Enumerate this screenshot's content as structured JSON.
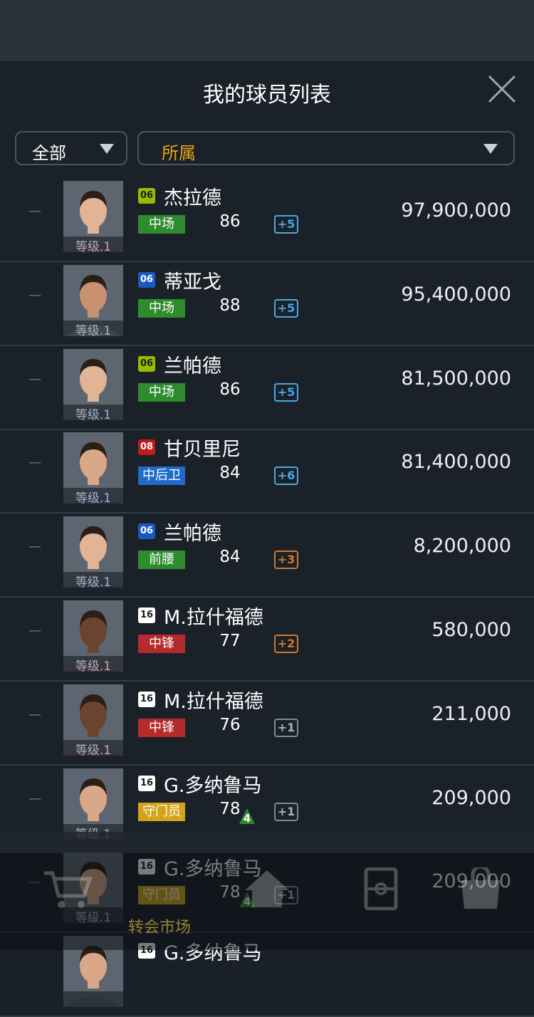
{
  "header": {
    "title": "我的球员列表"
  },
  "filters": {
    "category": "全部",
    "ownership": "所属"
  },
  "players": [
    {
      "dash": "—",
      "season": "06",
      "season_style": "s06g",
      "name": "杰拉德",
      "level": "等级.1",
      "position": "中场",
      "pos_style": "mid",
      "ovr": "86",
      "upgrade": "",
      "boost": "+5",
      "boost_style": "blue",
      "price": "97,900,000"
    },
    {
      "dash": "—",
      "season": "06",
      "season_style": "s06b",
      "name": "蒂亚戈",
      "level": "等级.1",
      "position": "中场",
      "pos_style": "mid",
      "ovr": "88",
      "upgrade": "",
      "boost": "+5",
      "boost_style": "blue",
      "price": "95,400,000"
    },
    {
      "dash": "—",
      "season": "06",
      "season_style": "s06g",
      "name": "兰帕德",
      "level": "等级.1",
      "position": "中场",
      "pos_style": "mid",
      "ovr": "86",
      "upgrade": "",
      "boost": "+5",
      "boost_style": "blue",
      "price": "81,500,000"
    },
    {
      "dash": "—",
      "season": "08",
      "season_style": "s08",
      "name": "甘贝里尼",
      "level": "等级.1",
      "position": "中后卫",
      "pos_style": "def",
      "ovr": "84",
      "upgrade": "",
      "boost": "+6",
      "boost_style": "blue",
      "price": "81,400,000"
    },
    {
      "dash": "—",
      "season": "06",
      "season_style": "s06b",
      "name": "兰帕德",
      "level": "等级.1",
      "position": "前腰",
      "pos_style": "mid",
      "ovr": "84",
      "upgrade": "",
      "boost": "+3",
      "boost_style": "orange",
      "price": "8,200,000"
    },
    {
      "dash": "—",
      "season": "16",
      "season_style": "s16",
      "name": "M.拉什福德",
      "level": "等级.1",
      "position": "中锋",
      "pos_style": "fwd",
      "ovr": "77",
      "upgrade": "",
      "boost": "+2",
      "boost_style": "orange",
      "price": "580,000"
    },
    {
      "dash": "—",
      "season": "16",
      "season_style": "s16",
      "name": "M.拉什福德",
      "level": "等级.1",
      "position": "中锋",
      "pos_style": "fwd",
      "ovr": "76",
      "upgrade": "",
      "boost": "+1",
      "boost_style": "gray",
      "price": "211,000"
    },
    {
      "dash": "—",
      "season": "16",
      "season_style": "s16",
      "name": "G.多纳鲁马",
      "level": "等级.1",
      "position": "守门员",
      "pos_style": "gk",
      "ovr": "78",
      "upgrade": "4",
      "boost": "+1",
      "boost_style": "gray",
      "price": "209,000"
    },
    {
      "dash": "—",
      "season": "16",
      "season_style": "s16",
      "name": "G.多纳鲁马",
      "level": "等级.1",
      "position": "守门员",
      "pos_style": "gk",
      "ovr": "78",
      "upgrade": "4",
      "boost": "+1",
      "boost_style": "gray",
      "price": "209,000"
    },
    {
      "dash": "",
      "season": "16",
      "season_style": "s16",
      "name": "G.多纳鲁马",
      "level": "",
      "position": "",
      "pos_style": "gk",
      "ovr": "",
      "upgrade": "",
      "boost": "",
      "boost_style": "gray",
      "price": ""
    }
  ],
  "bottom_nav": {
    "active_label": "转会市场",
    "items": [
      {
        "icon": "cart-icon"
      },
      {
        "icon": "home-icon"
      },
      {
        "icon": "pitch-icon"
      },
      {
        "icon": "bag-icon"
      }
    ]
  },
  "colors": {
    "background": "#1b2129",
    "accent": "#e8a317",
    "position_mid": "#2e8b2e",
    "position_def": "#1e6bc9",
    "position_fwd": "#b52a2a",
    "position_gk": "#d4a41a"
  }
}
